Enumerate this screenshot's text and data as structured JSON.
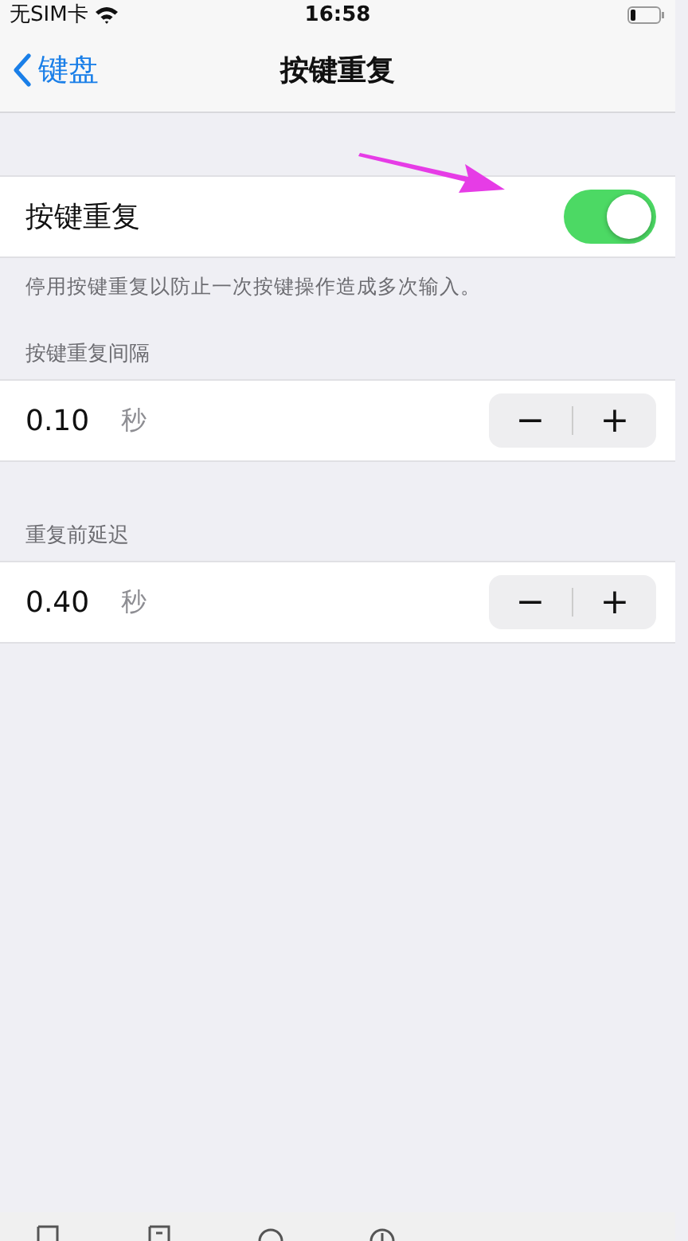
{
  "status_bar": {
    "carrier": "无SIM卡",
    "time": "16:58"
  },
  "nav": {
    "back": "键盘",
    "title": "按键重复"
  },
  "toggle": {
    "label": "按键重复",
    "on": true
  },
  "footnote": "停用按键重复以防止一次按键操作造成多次输入。",
  "steppers": [
    {
      "header": "按键重复间隔",
      "value": "0.10",
      "unit": "秒",
      "minus": "−",
      "plus": "+"
    },
    {
      "header": "重复前延迟",
      "value": "0.40",
      "unit": "秒",
      "minus": "−",
      "plus": "+"
    }
  ]
}
